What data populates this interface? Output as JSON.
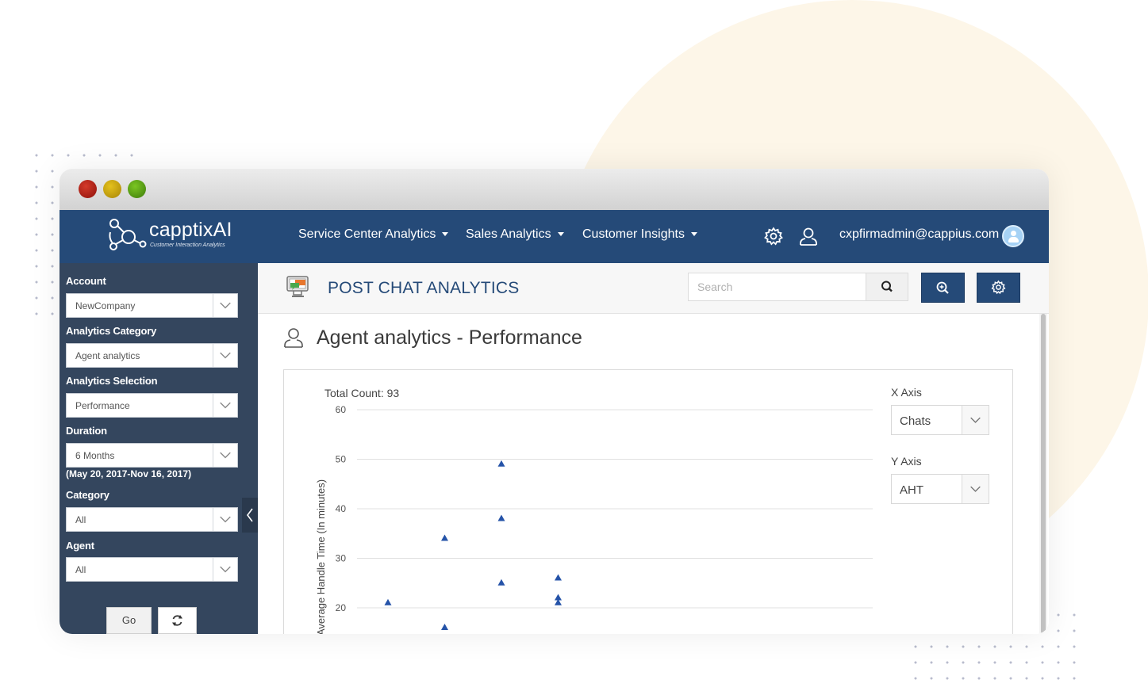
{
  "app": {
    "logo_text": "capptixAI",
    "logo_tagline": "Customer Interaction Analytics"
  },
  "nav": {
    "items": [
      {
        "label": "Service Center Analytics"
      },
      {
        "label": "Sales Analytics"
      },
      {
        "label": "Customer Insights"
      }
    ],
    "user_email": "cxpfirmadmin@cappius.com"
  },
  "sidebar": {
    "account_label": "Account",
    "account_value": "NewCompany",
    "category_label": "Analytics Category",
    "category_value": "Agent analytics",
    "selection_label": "Analytics Selection",
    "selection_value": "Performance",
    "duration_label": "Duration",
    "duration_value": "6 Months",
    "duration_note": "(May 20, 2017-Nov 16, 2017)",
    "cat_label": "Category",
    "cat_value": "All",
    "agent_label": "Agent",
    "agent_value": "All",
    "go_label": "Go"
  },
  "header": {
    "title": "POST CHAT ANALYTICS",
    "search_placeholder": "Search"
  },
  "section": {
    "title": "Agent analytics - Performance"
  },
  "controls": {
    "x_axis_label": "X Axis",
    "x_axis_value": "Chats",
    "y_axis_label": "Y Axis",
    "y_axis_value": "AHT"
  },
  "chart_data": {
    "type": "scatter",
    "title": "Total Count: 93",
    "ylabel": "Average Handle Time (In minutes)",
    "ylim": [
      20,
      60
    ],
    "yticks": [
      20,
      30,
      40,
      50,
      60
    ],
    "grid": true,
    "marker_color": "#2553a8",
    "points": [
      {
        "x": 1,
        "y": 21
      },
      {
        "x": 2,
        "y": 34
      },
      {
        "x": 2,
        "y": 16
      },
      {
        "x": 3,
        "y": 49
      },
      {
        "x": 3,
        "y": 38
      },
      {
        "x": 3,
        "y": 25
      },
      {
        "x": 4,
        "y": 26
      },
      {
        "x": 4,
        "y": 22
      },
      {
        "x": 4,
        "y": 21
      }
    ]
  },
  "colors": {
    "navbar": "#254a78",
    "sidebar": "#34465e",
    "accent": "#254a78"
  }
}
